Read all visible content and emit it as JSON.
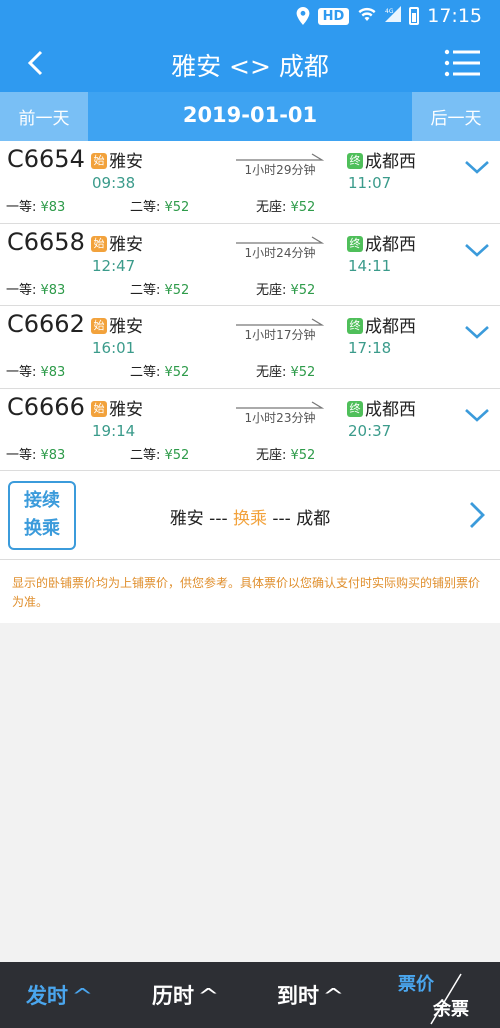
{
  "status_bar": {
    "hd": "HD",
    "time": "17:15",
    "icons": [
      "location-icon",
      "wifi-icon",
      "signal-4g-icon",
      "battery-icon"
    ]
  },
  "header": {
    "title": "雅安 <> 成都",
    "back_icon": "back-chevron-icon",
    "menu_icon": "menu-list-icon"
  },
  "date_bar": {
    "prev_label": "前一天",
    "date": "2019-01-01",
    "next_label": "后一天"
  },
  "trains": [
    {
      "number": "C6654",
      "start_badge": "始",
      "from": "雅安",
      "dep_time": "09:38",
      "duration": "1小时29分钟",
      "end_badge": "终",
      "to": "成都西",
      "arr_time": "11:07",
      "prices": [
        {
          "label": "一等: ",
          "value": "¥83"
        },
        {
          "label": "二等: ",
          "value": "¥52"
        },
        {
          "label": "无座: ",
          "value": "¥52"
        }
      ]
    },
    {
      "number": "C6658",
      "start_badge": "始",
      "from": "雅安",
      "dep_time": "12:47",
      "duration": "1小时24分钟",
      "end_badge": "终",
      "to": "成都西",
      "arr_time": "14:11",
      "prices": [
        {
          "label": "一等: ",
          "value": "¥83"
        },
        {
          "label": "二等: ",
          "value": "¥52"
        },
        {
          "label": "无座: ",
          "value": "¥52"
        }
      ]
    },
    {
      "number": "C6662",
      "start_badge": "始",
      "from": "雅安",
      "dep_time": "16:01",
      "duration": "1小时17分钟",
      "end_badge": "终",
      "to": "成都西",
      "arr_time": "17:18",
      "prices": [
        {
          "label": "一等: ",
          "value": "¥83"
        },
        {
          "label": "二等: ",
          "value": "¥52"
        },
        {
          "label": "无座: ",
          "value": "¥52"
        }
      ]
    },
    {
      "number": "C6666",
      "start_badge": "始",
      "from": "雅安",
      "dep_time": "19:14",
      "duration": "1小时23分钟",
      "end_badge": "终",
      "to": "成都西",
      "arr_time": "20:37",
      "prices": [
        {
          "label": "一等: ",
          "value": "¥83"
        },
        {
          "label": "二等: ",
          "value": "¥52"
        },
        {
          "label": "无座: ",
          "value": "¥52"
        }
      ]
    }
  ],
  "transfer": {
    "line1": "接续",
    "line2": "换乘",
    "from": "雅安 --- ",
    "via": "换乘",
    "to": " --- 成都"
  },
  "notice": "显示的卧铺票价均为上铺票价，供您参考。具体票价以您确认支付时实际购买的铺别票价为准。",
  "bottom_bar": {
    "sort_depart": "发时",
    "sort_duration": "历时",
    "sort_arrive": "到时",
    "caret": "^",
    "price_label": "票价",
    "remaining_label": "余票",
    "active_sort": "发时",
    "active_color": "#4aa6ee"
  },
  "colors": {
    "primary": "#2f9af0",
    "start_badge": "#f2a23c",
    "end_badge": "#4fbf5a",
    "price": "#2e9b4a",
    "time": "#3b9b8b",
    "notice": "#e08f2d"
  }
}
